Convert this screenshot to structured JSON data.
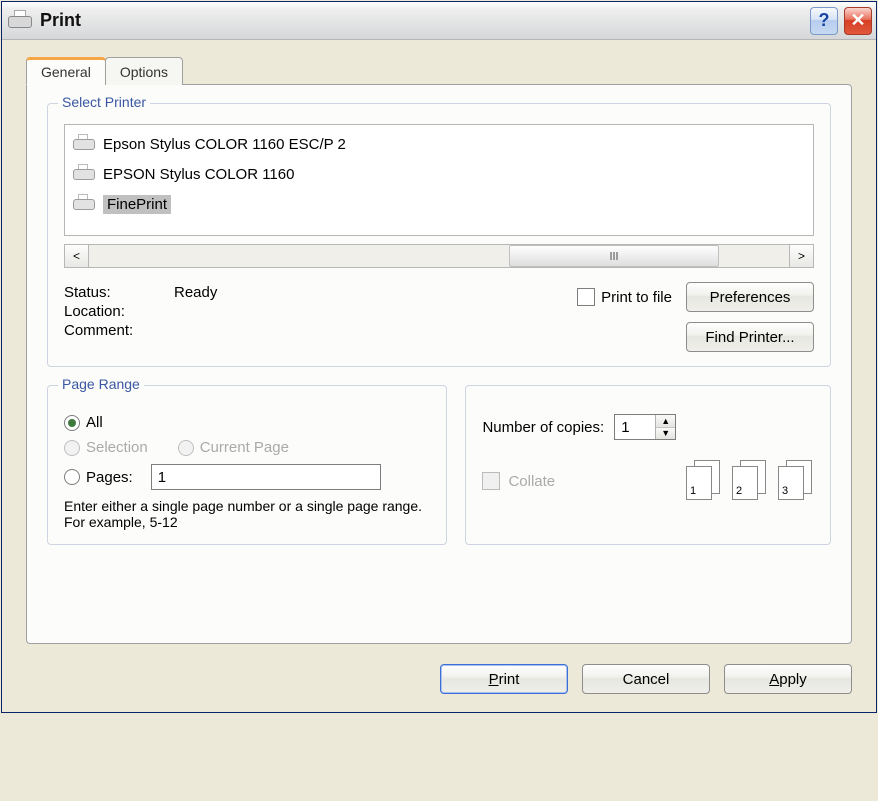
{
  "title": "Print",
  "tabs": {
    "general": "General",
    "options": "Options"
  },
  "select_printer": {
    "legend": "Select Printer",
    "printers": [
      {
        "name": "Epson Stylus COLOR 1160 ESC/P 2",
        "selected": false
      },
      {
        "name": "EPSON Stylus COLOR 1160",
        "selected": false
      },
      {
        "name": "FinePrint",
        "selected": true
      }
    ],
    "status_label": "Status:",
    "status_value": "Ready",
    "location_label": "Location:",
    "location_value": "",
    "comment_label": "Comment:",
    "comment_value": "",
    "print_to_file": "Print to file",
    "preferences_btn": "Preferences",
    "find_printer_btn": "Find Printer..."
  },
  "page_range": {
    "legend": "Page Range",
    "all": "All",
    "selection": "Selection",
    "current_page": "Current Page",
    "pages_label": "Pages:",
    "pages_value": "1",
    "hint": "Enter either a single page number or a single page range.  For example, 5-12"
  },
  "copies": {
    "copies_label_pre": "Number of ",
    "copies_label_u": "c",
    "copies_label_post": "opies:",
    "copies_value": "1",
    "collate": "Collate",
    "pairs": [
      "1",
      "2",
      "3"
    ]
  },
  "footer": {
    "print_pre": "",
    "print_u": "P",
    "print_post": "rint",
    "cancel": "Cancel",
    "apply_pre": "",
    "apply_u": "A",
    "apply_post": "pply"
  }
}
